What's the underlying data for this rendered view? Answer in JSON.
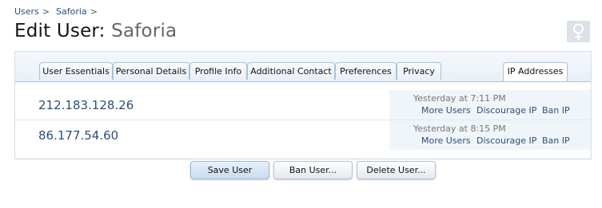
{
  "breadcrumb": {
    "items": [
      {
        "label": "Users",
        "separator": ">"
      },
      {
        "label": "Saforia",
        "separator": ">"
      }
    ]
  },
  "header": {
    "title_prefix": "Edit User:",
    "user_name": "Saforia",
    "gender_icon": "female-symbol-icon"
  },
  "tabs": [
    {
      "label": "User Essentials",
      "active": false
    },
    {
      "label": "Personal Details",
      "active": false
    },
    {
      "label": "Profile Info",
      "active": false
    },
    {
      "label": "Additional Contact",
      "active": false
    },
    {
      "label": "Preferences",
      "active": false
    },
    {
      "label": "Privacy",
      "active": false
    },
    {
      "label": "IP Addresses",
      "active": true
    }
  ],
  "ip_rows": [
    {
      "ip": "212.183.128.26",
      "time": "Yesterday at 7:11 PM",
      "actions": [
        "More Users",
        "Discourage IP",
        "Ban IP"
      ]
    },
    {
      "ip": "86.177.54.60",
      "time": "Yesterday at 8:15 PM",
      "actions": [
        "More Users",
        "Discourage IP",
        "Ban IP"
      ]
    }
  ],
  "buttons": {
    "save": "Save User",
    "ban": "Ban User...",
    "delete": "Delete User..."
  },
  "colors": {
    "link": "#2b4f77",
    "tab_border": "#a9c2dc",
    "info_background": "#f0f5fa"
  }
}
